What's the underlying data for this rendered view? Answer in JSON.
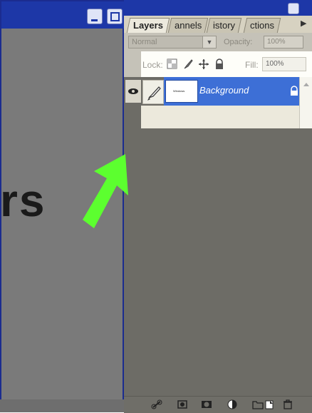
{
  "document": {
    "visible_text": "rs"
  },
  "palette": {
    "tabs": [
      {
        "label": "Layers"
      },
      {
        "label": "annels"
      },
      {
        "label": "istory"
      },
      {
        "label": "ctions"
      }
    ],
    "blend_mode": "Normal",
    "opacity_label": "Opacity:",
    "opacity_value": "100%",
    "lock_label": "Lock:",
    "fill_label": "Fill:",
    "fill_value": "100%",
    "layers": [
      {
        "name": "Background",
        "thumb_text": "Windows"
      }
    ]
  },
  "colors": {
    "titlebar": "#1d37a7",
    "selected_layer": "#3d6fd6",
    "arrow": "#5cff2f"
  }
}
